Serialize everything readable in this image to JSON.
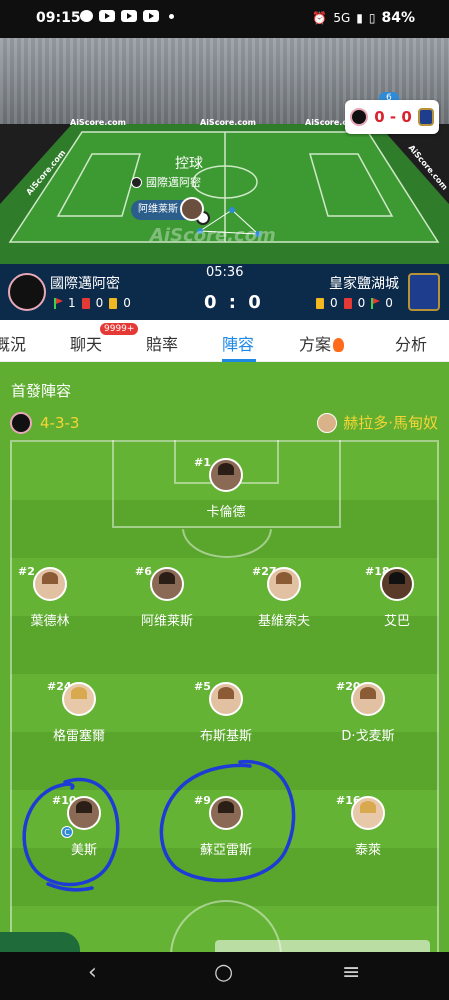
{
  "status_bar": {
    "time": "09:15",
    "network": "5G",
    "battery": "84%"
  },
  "match_view": {
    "possession_label": "控球",
    "possession_team": "國際邁阿密",
    "player_bubble": "阿维莱斯",
    "watermark": "AiScore.com",
    "brand_boards": [
      "AiScore.com",
      "AiScore.com",
      "AiScore.com",
      "AiScore.com",
      "AiScore.com"
    ],
    "minute_badge": "6",
    "mini_score": "0 - 0"
  },
  "scoreboard": {
    "home_team": "國際邁阿密",
    "away_team": "皇家鹽湖城",
    "match_time": "05:36",
    "score": "0 : 0",
    "home_stats": {
      "corners": "1",
      "red": "0",
      "yellow": "0"
    },
    "away_stats": {
      "yellow": "0",
      "red": "0",
      "corners": "0"
    }
  },
  "tabs": [
    {
      "label": "概況"
    },
    {
      "label": "聊天",
      "badge": "9999+"
    },
    {
      "label": "賠率"
    },
    {
      "label": "陣容",
      "active": true
    },
    {
      "label": "方案"
    },
    {
      "label": "分析"
    }
  ],
  "lineup": {
    "title": "首發陣容",
    "formation": "4-3-3",
    "coach": "赫拉多·馬甸奴",
    "captain_mark": "C",
    "players": [
      {
        "number": "#1",
        "name": "卡倫德"
      },
      {
        "number": "#2",
        "name": "葉德林"
      },
      {
        "number": "#6",
        "name": "阿维莱斯"
      },
      {
        "number": "#27",
        "name": "基維索夫"
      },
      {
        "number": "#18",
        "name": "艾巴"
      },
      {
        "number": "#24",
        "name": "格雷塞爾"
      },
      {
        "number": "#5",
        "name": "布斯基斯"
      },
      {
        "number": "#20",
        "name": "D·戈麦斯"
      },
      {
        "number": "#10",
        "name": "美斯"
      },
      {
        "number": "#9",
        "name": "蘇亞雷斯"
      },
      {
        "number": "#16",
        "name": "泰萊"
      }
    ]
  },
  "nav": {
    "back": "‹",
    "home": "○",
    "recents": "≡"
  }
}
